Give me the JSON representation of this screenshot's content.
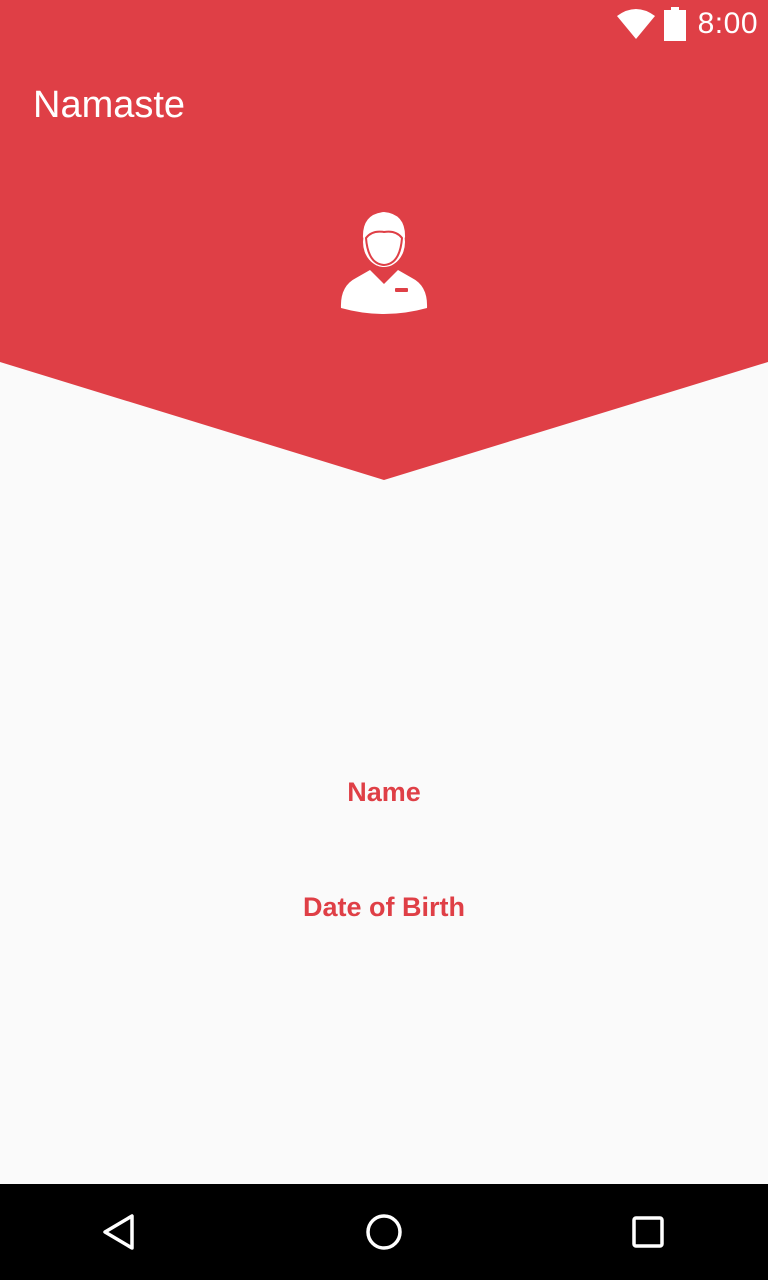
{
  "colors": {
    "accent": "#df3f46",
    "background": "#fafafa",
    "nav_bar": "#000000",
    "on_accent": "#ffffff"
  },
  "status_bar": {
    "time": "8:00",
    "icons": [
      "wifi-icon",
      "battery-icon"
    ]
  },
  "toolbar": {
    "title": "Namaste"
  },
  "profile": {
    "avatar_icon": "user-avatar-icon",
    "name_label": "Name",
    "dob_label": "Date of Birth"
  },
  "nav_bar": {
    "buttons": [
      "back-icon",
      "home-icon",
      "recents-icon"
    ]
  }
}
